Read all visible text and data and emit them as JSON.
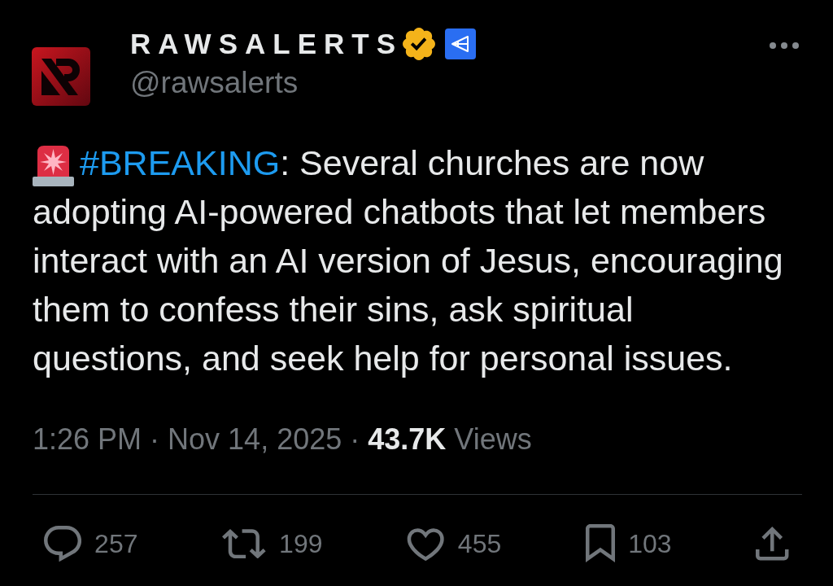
{
  "post": {
    "author": {
      "name": "RAWSALERTS",
      "handle": "@rawsalerts",
      "verified": true,
      "affiliated": true
    },
    "body": {
      "hashtag": "#BREAKING",
      "text": ": Several churches are now adopting AI-powered chatbots that let members interact with an AI version of Jesus, encouraging them to confess their sins, ask spiritual questions, and seek help for personal issues."
    },
    "meta": {
      "timestamp": "1:26 PM · Nov 14, 2025",
      "separator": "·",
      "views": "**43.7K** Views"
    },
    "actions": [
      {
        "kind": "reply",
        "count": "257"
      },
      {
        "kind": "repost",
        "count": "199"
      },
      {
        "kind": "like",
        "count": "455"
      },
      {
        "kind": "bookmark",
        "count": "103"
      },
      {
        "kind": "share"
      }
    ]
  }
}
